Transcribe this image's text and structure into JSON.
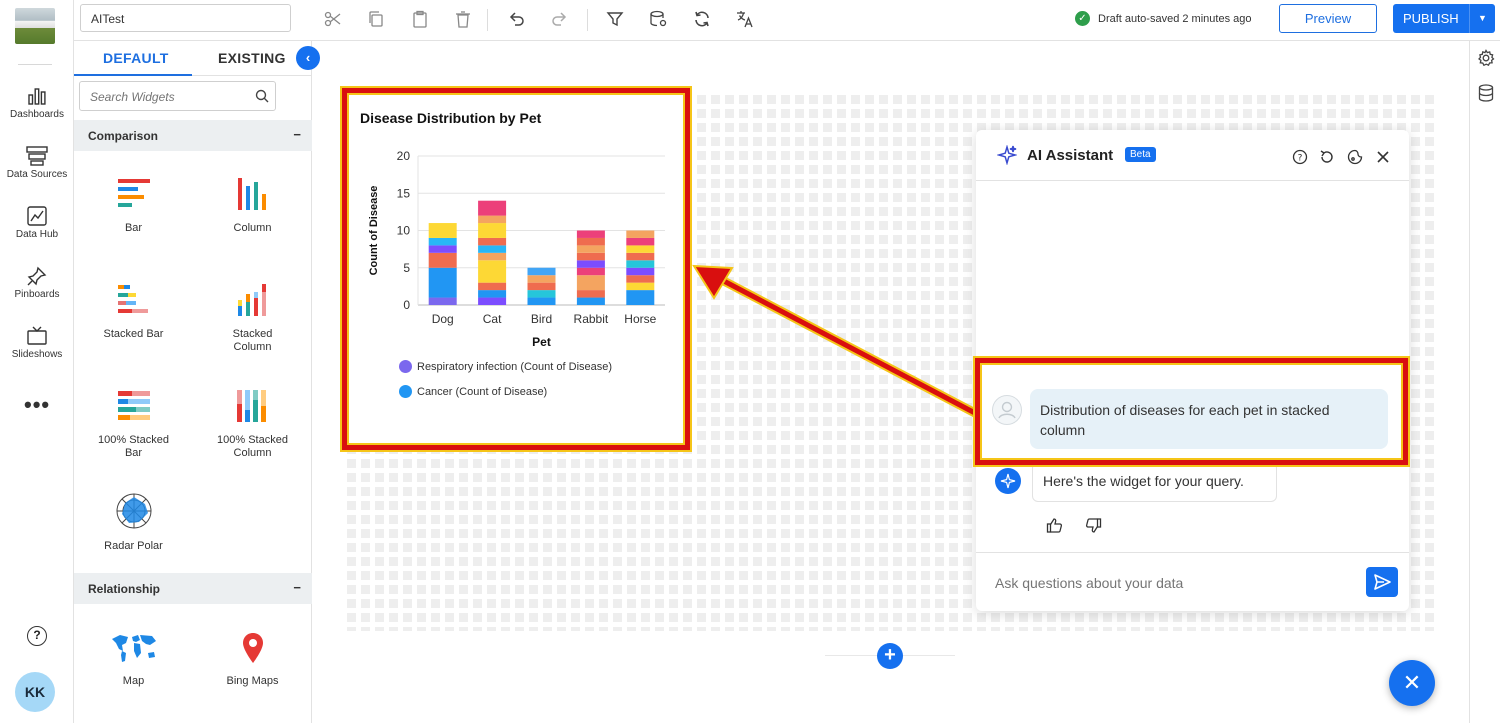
{
  "nav": {
    "items": [
      {
        "label": "Dashboards",
        "icon": "bar-chart-icon"
      },
      {
        "label": "Data Sources",
        "icon": "server-icon"
      },
      {
        "label": "Data Hub",
        "icon": "chart-box-icon"
      },
      {
        "label": "Pinboards",
        "icon": "pin-icon"
      },
      {
        "label": "Slideshows",
        "icon": "tv-icon"
      }
    ],
    "more": "•••",
    "help": "?",
    "avatar": "KK"
  },
  "toolbar": {
    "title_value": "AITest",
    "saved_status": "Draft auto-saved 2 minutes ago",
    "preview_label": "Preview",
    "publish_label": "PUBLISH"
  },
  "panel": {
    "tab_default": "DEFAULT",
    "tab_existing": "EXISTING",
    "search_placeholder": "Search Widgets",
    "section_comparison": "Comparison",
    "section_relationship": "Relationship",
    "collapse_symbol": "−",
    "widgets": {
      "bar": "Bar",
      "column": "Column",
      "stacked_bar": "Stacked Bar",
      "stacked_column_1": "Stacked",
      "stacked_column_2": "Column",
      "pct_stacked_bar_1": "100% Stacked",
      "pct_stacked_bar_2": "Bar",
      "pct_stacked_col_1": "100% Stacked",
      "pct_stacked_col_2": "Column",
      "radar": "Radar Polar",
      "map": "Map",
      "bing_maps": "Bing Maps"
    }
  },
  "chart_data": {
    "type": "bar",
    "stacked": true,
    "title": "Disease Distribution by Pet",
    "xlabel": "Pet",
    "ylabel": "Count of Disease",
    "categories": [
      "Dog",
      "Cat",
      "Bird",
      "Rabbit",
      "Horse"
    ],
    "ylim": [
      0,
      20
    ],
    "yticks": [
      0,
      5,
      10,
      15,
      20
    ],
    "totals": [
      11,
      14,
      5,
      10,
      10
    ],
    "segments": [
      [
        {
          "v": 1,
          "c": "#7b68ee"
        },
        {
          "v": 4,
          "c": "#2196f3"
        },
        {
          "v": 2,
          "c": "#ef6c4f"
        },
        {
          "v": 1,
          "c": "#7c4dff"
        },
        {
          "v": 1,
          "c": "#29b6f6"
        },
        {
          "v": 2,
          "c": "#fdd835"
        }
      ],
      [
        {
          "v": 1,
          "c": "#7c4dff"
        },
        {
          "v": 1,
          "c": "#2196f3"
        },
        {
          "v": 1,
          "c": "#ef6c4f"
        },
        {
          "v": 3,
          "c": "#fdd835"
        },
        {
          "v": 1,
          "c": "#f4a460"
        },
        {
          "v": 1,
          "c": "#29b6f6"
        },
        {
          "v": 1,
          "c": "#ef6c4f"
        },
        {
          "v": 2,
          "c": "#fdd835"
        },
        {
          "v": 1,
          "c": "#f4a460"
        },
        {
          "v": 2,
          "c": "#ec407a"
        }
      ],
      [
        {
          "v": 1,
          "c": "#2196f3"
        },
        {
          "v": 1,
          "c": "#26c6da"
        },
        {
          "v": 1,
          "c": "#ef6c4f"
        },
        {
          "v": 1,
          "c": "#f4a460"
        },
        {
          "v": 1,
          "c": "#42a5f5"
        }
      ],
      [
        {
          "v": 1,
          "c": "#2196f3"
        },
        {
          "v": 1,
          "c": "#ef6c4f"
        },
        {
          "v": 2,
          "c": "#f4a460"
        },
        {
          "v": 1,
          "c": "#ec407a"
        },
        {
          "v": 1,
          "c": "#7c4dff"
        },
        {
          "v": 1,
          "c": "#ef6c4f"
        },
        {
          "v": 1,
          "c": "#f4a460"
        },
        {
          "v": 1,
          "c": "#ef6c4f"
        },
        {
          "v": 1,
          "c": "#ec407a"
        }
      ],
      [
        {
          "v": 2,
          "c": "#2196f3"
        },
        {
          "v": 1,
          "c": "#fdd835"
        },
        {
          "v": 1,
          "c": "#ef6c4f"
        },
        {
          "v": 1,
          "c": "#7c4dff"
        },
        {
          "v": 1,
          "c": "#26c6da"
        },
        {
          "v": 1,
          "c": "#ef6c4f"
        },
        {
          "v": 1,
          "c": "#fdd835"
        },
        {
          "v": 1,
          "c": "#ec407a"
        },
        {
          "v": 1,
          "c": "#f4a460"
        }
      ]
    ],
    "legend": [
      {
        "name": "Respiratory infection (Count of Disease)",
        "color": "#7b68ee"
      },
      {
        "name": "Cancer (Count of Disease)",
        "color": "#2196f3"
      }
    ]
  },
  "ai": {
    "title": "AI Assistant",
    "badge": "Beta",
    "user_message": "Distribution of diseases for each pet in stacked column",
    "bot_message": "Here's the widget for your query.",
    "input_placeholder": "Ask questions about your data"
  },
  "canvas": {
    "add_symbol": "+",
    "close_symbol": "✕"
  },
  "colors": {
    "accent": "#1570ef",
    "highlight_border": "#d90f0f",
    "highlight_glow": "#f5c518"
  }
}
